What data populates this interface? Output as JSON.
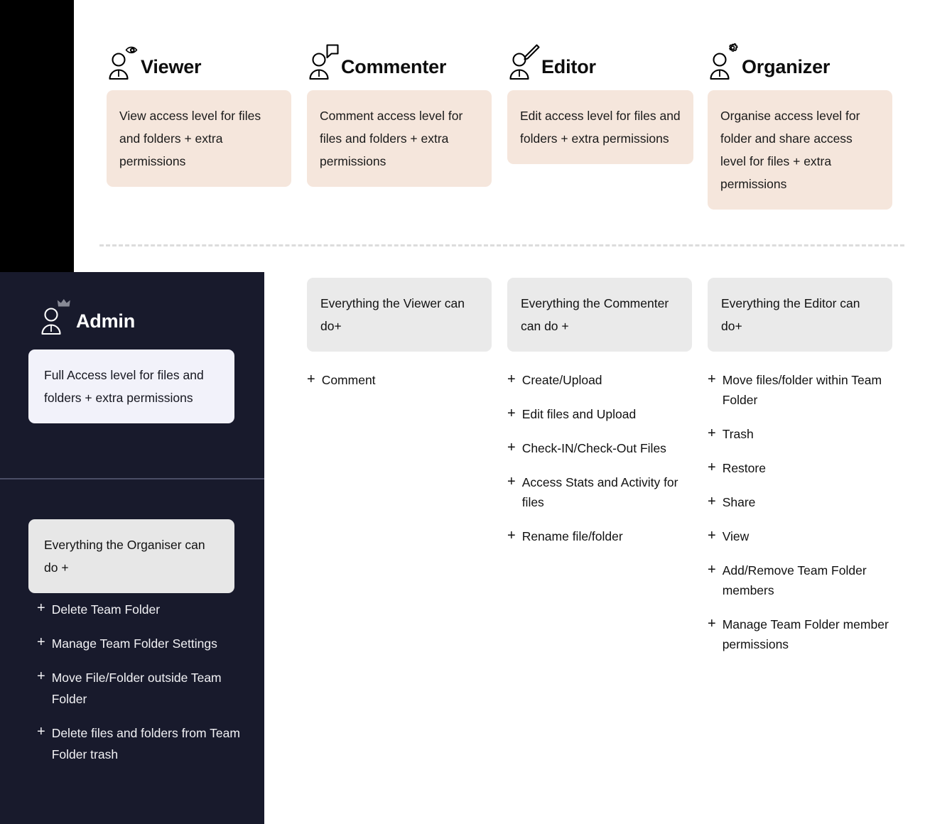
{
  "colors": {
    "peach_card": "#f5e6dc",
    "grey_card": "#eaeaea",
    "navy_panel": "#181a2c",
    "admin_card": "#f2f2fa",
    "black_block": "#000000",
    "dashed_divider": "#dcdcdc"
  },
  "roles": [
    {
      "id": "viewer",
      "title": "Viewer",
      "icon": "person-eye-icon",
      "description": "View access level for files and folders + extra permissions"
    },
    {
      "id": "commenter",
      "title": "Commenter",
      "icon": "person-comment-icon",
      "description": "Comment access level for files and folders + extra permissions"
    },
    {
      "id": "editor",
      "title": "Editor",
      "icon": "person-pencil-icon",
      "description": "Edit access level for files and folders + extra permissions"
    },
    {
      "id": "organizer",
      "title": "Organizer",
      "icon": "person-gear-icon",
      "description": "Organise access level for folder and share access level for files + extra permissions"
    }
  ],
  "permission_columns": [
    {
      "id": "commenter-permissions",
      "banner": "Everything the Viewer can do+",
      "items": [
        "Comment"
      ]
    },
    {
      "id": "editor-permissions",
      "banner": "Everything the Commenter can do +",
      "items": [
        "Create/Upload",
        "Edit files and Upload",
        "Check-IN/Check-Out Files",
        "Access Stats and Activity for files",
        "Rename file/folder"
      ]
    },
    {
      "id": "organizer-permissions",
      "banner": "Everything the Editor can do+",
      "items": [
        "Move files/folder within Team Folder",
        "Trash",
        "Restore",
        "Share",
        "View",
        "Add/Remove Team Folder members",
        "Manage Team Folder member permissions"
      ]
    }
  ],
  "admin": {
    "title": "Admin",
    "icon": "person-crown-icon",
    "description": "Full Access level for files and folders + extra permissions",
    "banner": "Everything the Organiser can do +",
    "items": [
      "Delete Team Folder",
      "Manage Team Folder Settings",
      "Move File/Folder outside Team Folder",
      "Delete files and folders from Team Folder trash"
    ]
  },
  "plus_symbol": "+"
}
